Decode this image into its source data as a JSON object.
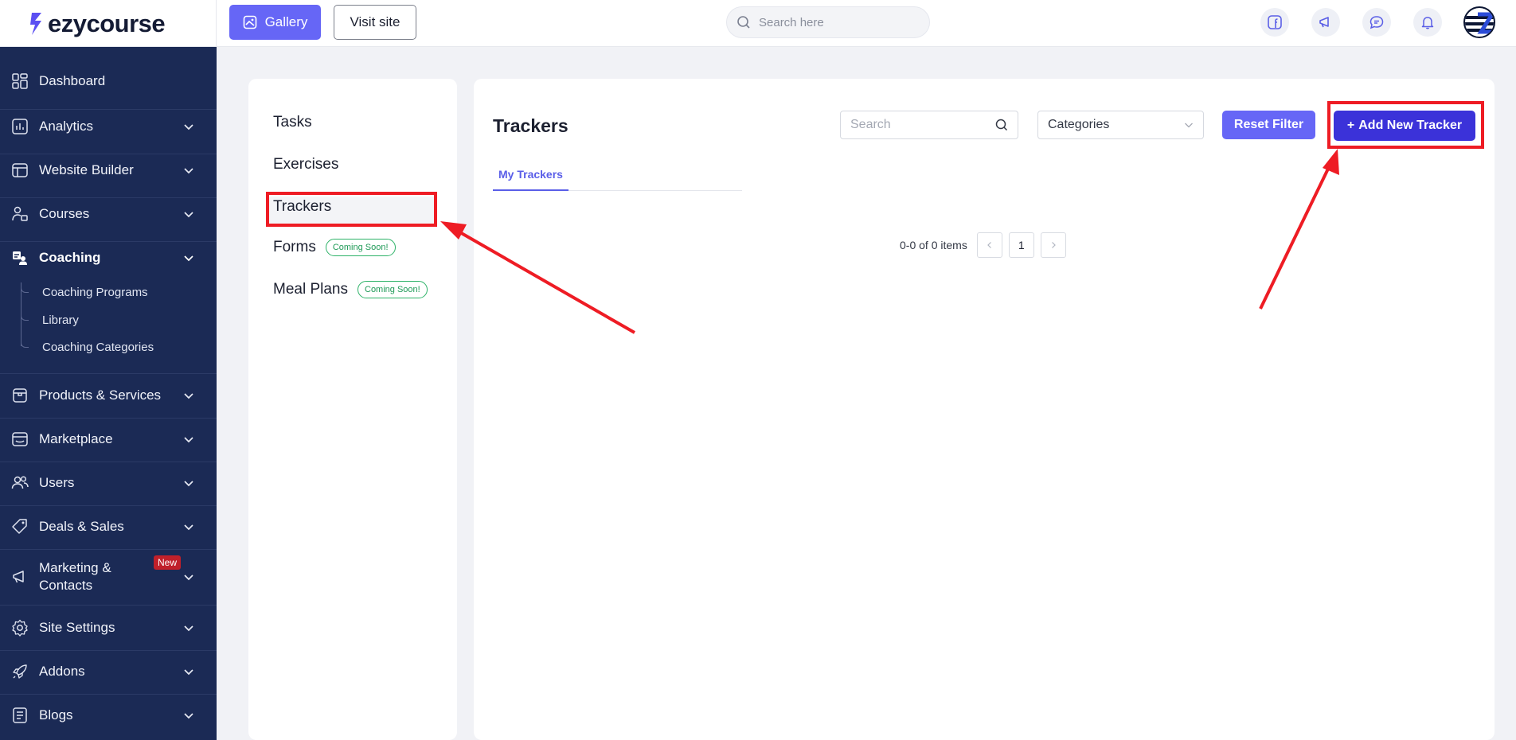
{
  "brand": {
    "name": "ezycourse"
  },
  "topbar": {
    "gallery_label": "Gallery",
    "visit_label": "Visit site",
    "search_placeholder": "Search here",
    "icons": [
      "facebook-icon",
      "megaphone-icon",
      "chat-icon",
      "bell-icon"
    ]
  },
  "sidebar": {
    "items": [
      {
        "label": "Dashboard",
        "icon": "dashboard-icon"
      },
      {
        "label": "Analytics",
        "icon": "analytics-icon"
      },
      {
        "label": "Website Builder",
        "icon": "website-builder-icon"
      },
      {
        "label": "Courses",
        "icon": "courses-icon"
      },
      {
        "label": "Coaching",
        "icon": "coaching-icon"
      },
      {
        "label": "Products & Services",
        "icon": "box-icon"
      },
      {
        "label": "Marketplace",
        "icon": "store-icon"
      },
      {
        "label": "Users",
        "icon": "users-icon"
      },
      {
        "label": "Deals & Sales",
        "icon": "tag-icon"
      },
      {
        "label": "Marketing & Contacts",
        "icon": "megaphone-icon",
        "badge": "New"
      },
      {
        "label": "Site Settings",
        "icon": "gear-icon"
      },
      {
        "label": "Addons",
        "icon": "rocket-icon"
      },
      {
        "label": "Blogs",
        "icon": "blog-icon"
      }
    ],
    "coaching_sub": [
      "Coaching Programs",
      "Library",
      "Coaching Categories"
    ],
    "marketing_line1": "Marketing &",
    "marketing_line2": "Contacts"
  },
  "left_menu": {
    "items": [
      {
        "label": "Tasks"
      },
      {
        "label": "Exercises"
      },
      {
        "label": "Trackers"
      },
      {
        "label": "Forms",
        "badge": "Coming Soon!"
      },
      {
        "label": "Meal Plans",
        "badge": "Coming Soon!"
      }
    ]
  },
  "main": {
    "title": "Trackers",
    "search_placeholder": "Search",
    "categories_label": "Categories",
    "reset_label": "Reset Filter",
    "add_label": "Add New Tracker",
    "add_prefix": "+",
    "tab": "My Trackers",
    "pagination": {
      "summary": "0-0 of 0 items",
      "current_page": "1"
    }
  },
  "colors": {
    "sidebar_bg": "#1b2a55",
    "accent": "#6666f6",
    "primary_button": "#3b32d9",
    "annotation": "#ee1c24"
  }
}
